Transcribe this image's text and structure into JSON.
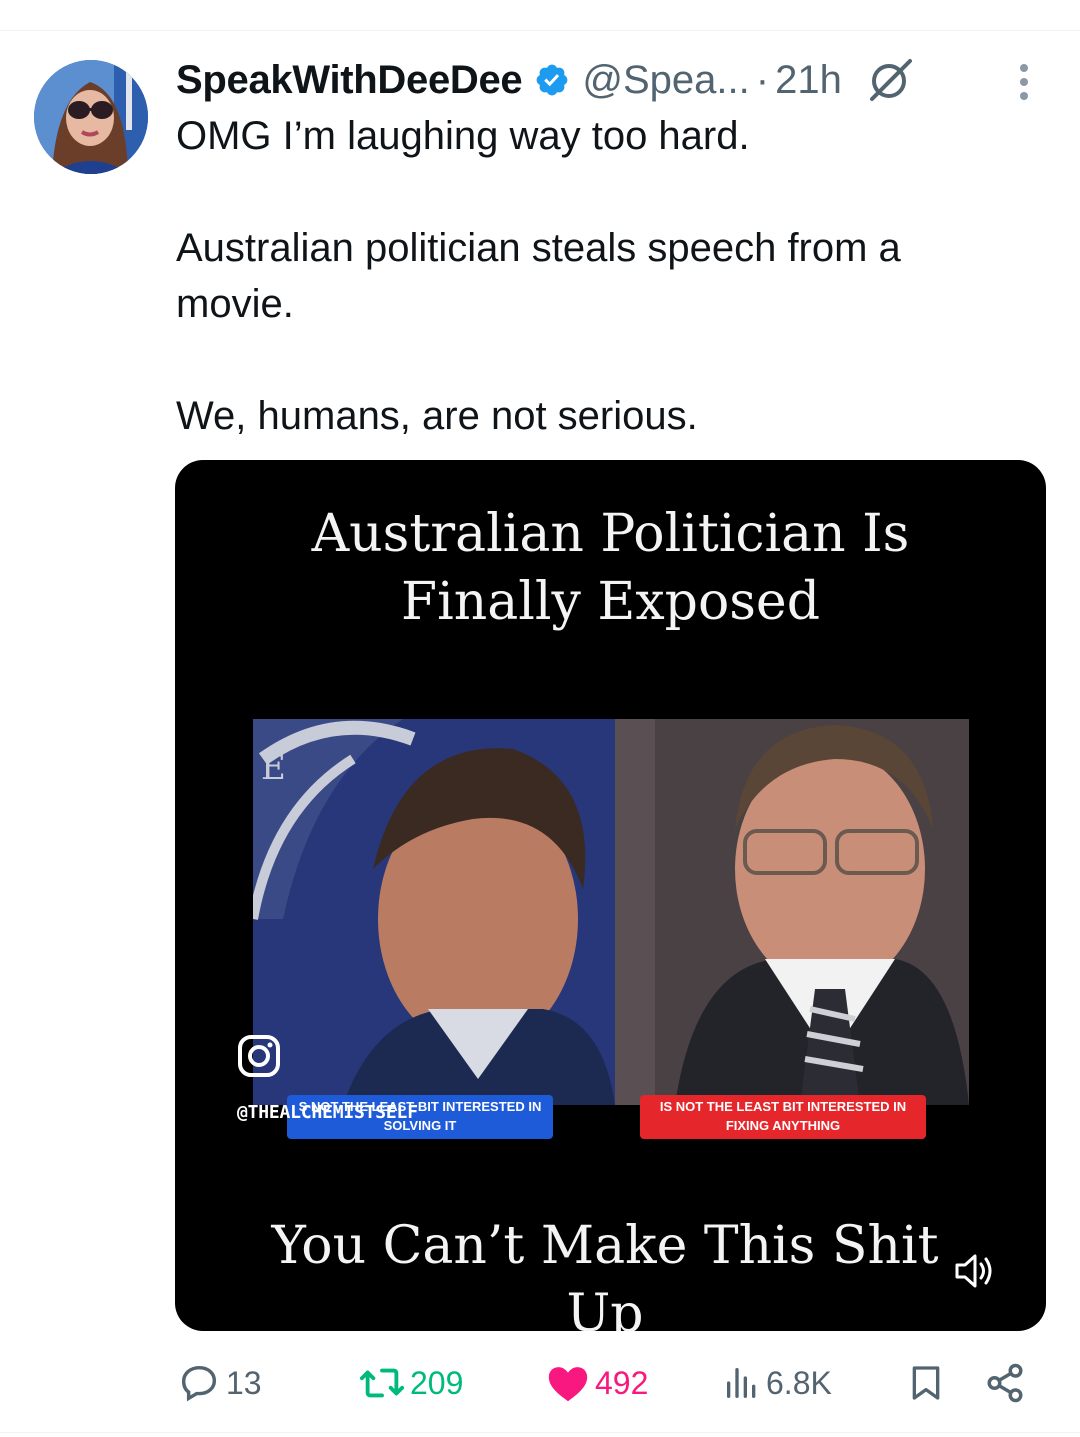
{
  "author": {
    "name": "SpeakWithDeeDee",
    "handle": "@Spea...",
    "separator": "·",
    "time": "21h",
    "verified_color": "#1d9bf0"
  },
  "tweet": {
    "lines": [
      "OMG I’m laughing way too hard.",
      "Australian politician steals speech from a movie.",
      "We, humans, are not serious."
    ]
  },
  "video": {
    "title_line1": "Australian Politician Is",
    "title_line2": "Finally Exposed",
    "caption_left_line1": "S NOT THE LEAST BIT INTERESTED IN",
    "caption_left_line2": "SOLVING IT",
    "caption_right_line1": "IS NOT THE LEAST BIT INTERESTED IN",
    "caption_right_line2": "FIXING ANYTHING",
    "watermark": "@THEALCHEMISTSELF",
    "bottom_line1": "You Can’t Make This Shit",
    "bottom_line2": "Up"
  },
  "actions": {
    "replies": "13",
    "retweets": "209",
    "likes": "492",
    "views": "6.8K",
    "retweet_color": "#00ba7c",
    "like_color": "#f91880"
  }
}
